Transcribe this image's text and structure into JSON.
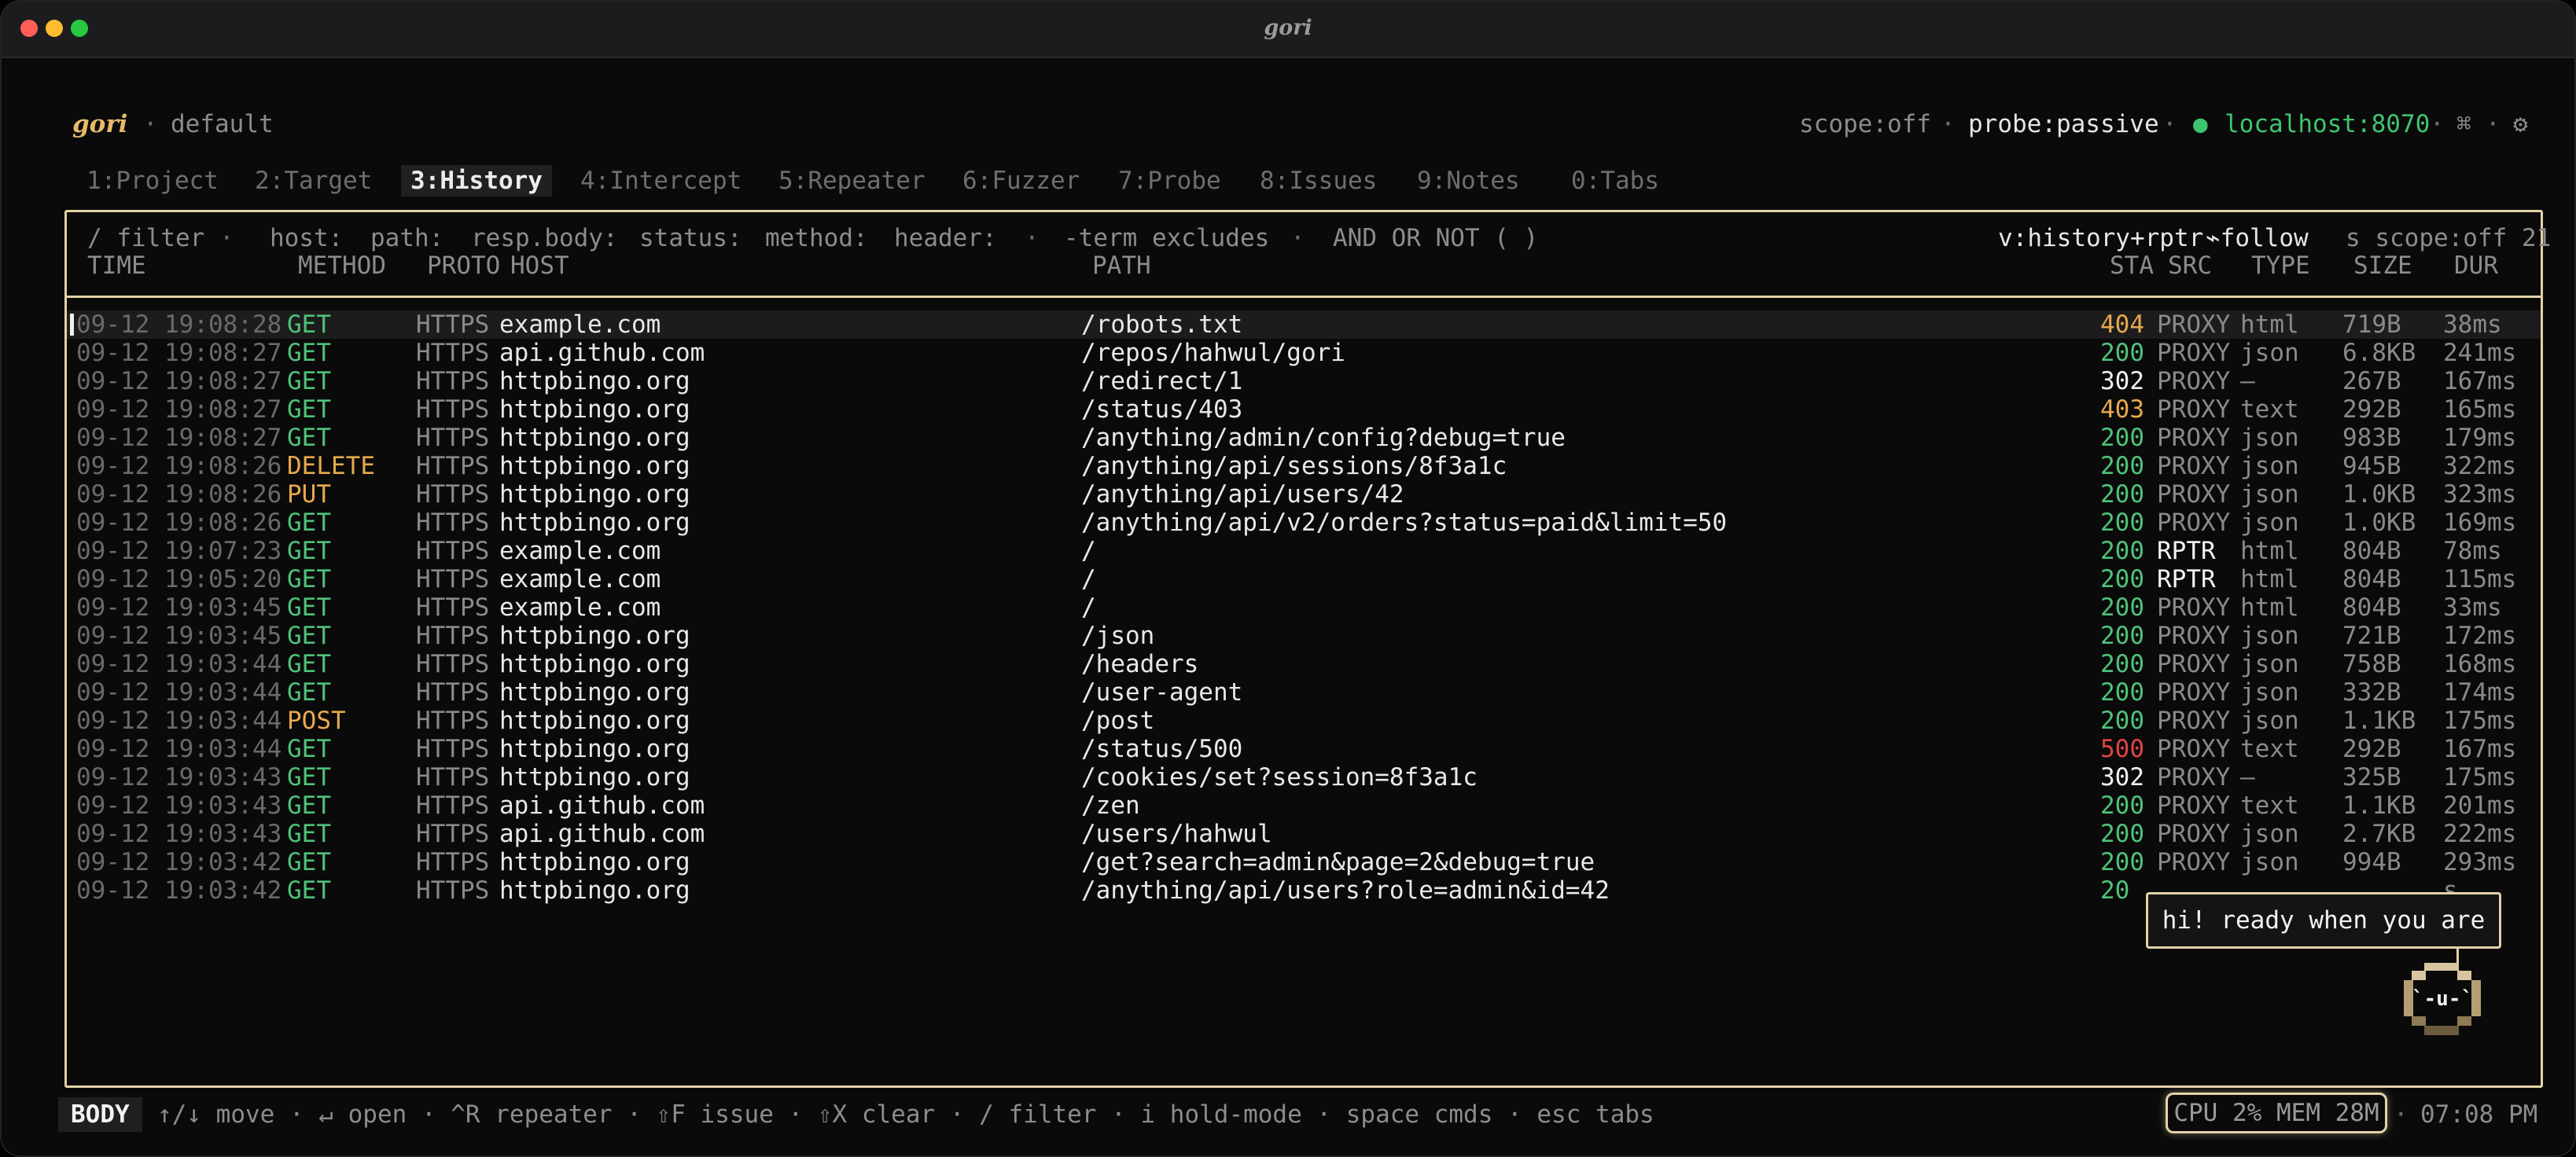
{
  "window": {
    "title": "gori"
  },
  "header": {
    "brand": "gori",
    "sep": "·",
    "project": "default",
    "scope": "scope:off",
    "probe": "probe:passive",
    "dot": "●",
    "server": "localhost:8070",
    "cmd_icon": "⌘",
    "gear_icon": "⚙"
  },
  "tabs": [
    {
      "label": "1:Project"
    },
    {
      "label": "2:Target"
    },
    {
      "label": "3:History"
    },
    {
      "label": "4:Intercept"
    },
    {
      "label": "5:Repeater"
    },
    {
      "label": "6:Fuzzer"
    },
    {
      "label": "7:Probe"
    },
    {
      "label": "8:Issues"
    },
    {
      "label": "9:Notes"
    },
    {
      "label": "0:Tabs"
    }
  ],
  "filter": {
    "placeholder": "/ filter",
    "sep": "·",
    "hints": [
      "host:",
      "path:",
      "resp.body:",
      "status:",
      "method:",
      "header:"
    ],
    "exclude_hint": "-term excludes",
    "ops": "AND OR NOT ( )",
    "view": "v:history+rptr",
    "follow": "⌁follow",
    "status_right": "s scope:off 21"
  },
  "columns": {
    "time": "TIME",
    "method": "METHOD",
    "proto": "PROTO",
    "host": "HOST",
    "path": "PATH",
    "status": "STA",
    "src": "SRC",
    "type": "TYPE",
    "size": "SIZE",
    "dur": "DUR"
  },
  "rows": [
    {
      "time": "09-12 19:08:28",
      "method": "GET",
      "proto": "HTTPS",
      "host": "example.com",
      "path": "/robots.txt",
      "status": "404",
      "src": "PROXY",
      "type": "html",
      "size": "719B",
      "dur": "38ms",
      "selected": true
    },
    {
      "time": "09-12 19:08:27",
      "method": "GET",
      "proto": "HTTPS",
      "host": "api.github.com",
      "path": "/repos/hahwul/gori",
      "status": "200",
      "src": "PROXY",
      "type": "json",
      "size": "6.8KB",
      "dur": "241ms"
    },
    {
      "time": "09-12 19:08:27",
      "method": "GET",
      "proto": "HTTPS",
      "host": "httpbingo.org",
      "path": "/redirect/1",
      "status": "302",
      "src": "PROXY",
      "type": "—",
      "size": "267B",
      "dur": "167ms"
    },
    {
      "time": "09-12 19:08:27",
      "method": "GET",
      "proto": "HTTPS",
      "host": "httpbingo.org",
      "path": "/status/403",
      "status": "403",
      "src": "PROXY",
      "type": "text",
      "size": "292B",
      "dur": "165ms"
    },
    {
      "time": "09-12 19:08:27",
      "method": "GET",
      "proto": "HTTPS",
      "host": "httpbingo.org",
      "path": "/anything/admin/config?debug=true",
      "status": "200",
      "src": "PROXY",
      "type": "json",
      "size": "983B",
      "dur": "179ms"
    },
    {
      "time": "09-12 19:08:26",
      "method": "DELETE",
      "proto": "HTTPS",
      "host": "httpbingo.org",
      "path": "/anything/api/sessions/8f3a1c",
      "status": "200",
      "src": "PROXY",
      "type": "json",
      "size": "945B",
      "dur": "322ms"
    },
    {
      "time": "09-12 19:08:26",
      "method": "PUT",
      "proto": "HTTPS",
      "host": "httpbingo.org",
      "path": "/anything/api/users/42",
      "status": "200",
      "src": "PROXY",
      "type": "json",
      "size": "1.0KB",
      "dur": "323ms"
    },
    {
      "time": "09-12 19:08:26",
      "method": "GET",
      "proto": "HTTPS",
      "host": "httpbingo.org",
      "path": "/anything/api/v2/orders?status=paid&limit=50",
      "status": "200",
      "src": "PROXY",
      "type": "json",
      "size": "1.0KB",
      "dur": "169ms"
    },
    {
      "time": "09-12 19:07:23",
      "method": "GET",
      "proto": "HTTPS",
      "host": "example.com",
      "path": "/",
      "status": "200",
      "src": "RPTR",
      "type": "html",
      "size": "804B",
      "dur": "78ms"
    },
    {
      "time": "09-12 19:05:20",
      "method": "GET",
      "proto": "HTTPS",
      "host": "example.com",
      "path": "/",
      "status": "200",
      "src": "RPTR",
      "type": "html",
      "size": "804B",
      "dur": "115ms"
    },
    {
      "time": "09-12 19:03:45",
      "method": "GET",
      "proto": "HTTPS",
      "host": "example.com",
      "path": "/",
      "status": "200",
      "src": "PROXY",
      "type": "html",
      "size": "804B",
      "dur": "33ms"
    },
    {
      "time": "09-12 19:03:45",
      "method": "GET",
      "proto": "HTTPS",
      "host": "httpbingo.org",
      "path": "/json",
      "status": "200",
      "src": "PROXY",
      "type": "json",
      "size": "721B",
      "dur": "172ms"
    },
    {
      "time": "09-12 19:03:44",
      "method": "GET",
      "proto": "HTTPS",
      "host": "httpbingo.org",
      "path": "/headers",
      "status": "200",
      "src": "PROXY",
      "type": "json",
      "size": "758B",
      "dur": "168ms"
    },
    {
      "time": "09-12 19:03:44",
      "method": "GET",
      "proto": "HTTPS",
      "host": "httpbingo.org",
      "path": "/user-agent",
      "status": "200",
      "src": "PROXY",
      "type": "json",
      "size": "332B",
      "dur": "174ms"
    },
    {
      "time": "09-12 19:03:44",
      "method": "POST",
      "proto": "HTTPS",
      "host": "httpbingo.org",
      "path": "/post",
      "status": "200",
      "src": "PROXY",
      "type": "json",
      "size": "1.1KB",
      "dur": "175ms"
    },
    {
      "time": "09-12 19:03:44",
      "method": "GET",
      "proto": "HTTPS",
      "host": "httpbingo.org",
      "path": "/status/500",
      "status": "500",
      "src": "PROXY",
      "type": "text",
      "size": "292B",
      "dur": "167ms"
    },
    {
      "time": "09-12 19:03:43",
      "method": "GET",
      "proto": "HTTPS",
      "host": "httpbingo.org",
      "path": "/cookies/set?session=8f3a1c",
      "status": "302",
      "src": "PROXY",
      "type": "—",
      "size": "325B",
      "dur": "175ms"
    },
    {
      "time": "09-12 19:03:43",
      "method": "GET",
      "proto": "HTTPS",
      "host": "api.github.com",
      "path": "/zen",
      "status": "200",
      "src": "PROXY",
      "type": "text",
      "size": "1.1KB",
      "dur": "201ms"
    },
    {
      "time": "09-12 19:03:43",
      "method": "GET",
      "proto": "HTTPS",
      "host": "api.github.com",
      "path": "/users/hahwul",
      "status": "200",
      "src": "PROXY",
      "type": "json",
      "size": "2.7KB",
      "dur": "222ms"
    },
    {
      "time": "09-12 19:03:42",
      "method": "GET",
      "proto": "HTTPS",
      "host": "httpbingo.org",
      "path": "/get?search=admin&page=2&debug=true",
      "status": "200",
      "src": "PROXY",
      "type": "json",
      "size": "994B",
      "dur": "293ms"
    },
    {
      "time": "09-12 19:03:42",
      "method": "GET",
      "proto": "HTTPS",
      "host": "httpbingo.org",
      "path": "/anything/api/users?role=admin&id=42",
      "status": "20",
      "src": "",
      "type": "",
      "size": "",
      "dur": "s"
    }
  ],
  "mascot": {
    "speech": "hi! ready when you are",
    "face": "`-u-`"
  },
  "statusbar": {
    "mode": "BODY",
    "hints": "↑/↓ move · ↵ open · ^R repeater · ⇧F issue · ⇧X clear · / filter · i hold-mode · space cmds · esc tabs",
    "resources": "CPU 2% MEM 28M",
    "sep": "·",
    "clock": "07:08 PM"
  },
  "colors": {
    "accent": "#e3d2a8",
    "brand": "#e8b96a",
    "get": "#4ec27a",
    "mutate": "#e8a94c",
    "ok": "#4ec27a",
    "redirect": "#f0f0f0",
    "client_error": "#e8a94c",
    "server_error": "#e04545",
    "server_ok": "#3fc46e"
  }
}
